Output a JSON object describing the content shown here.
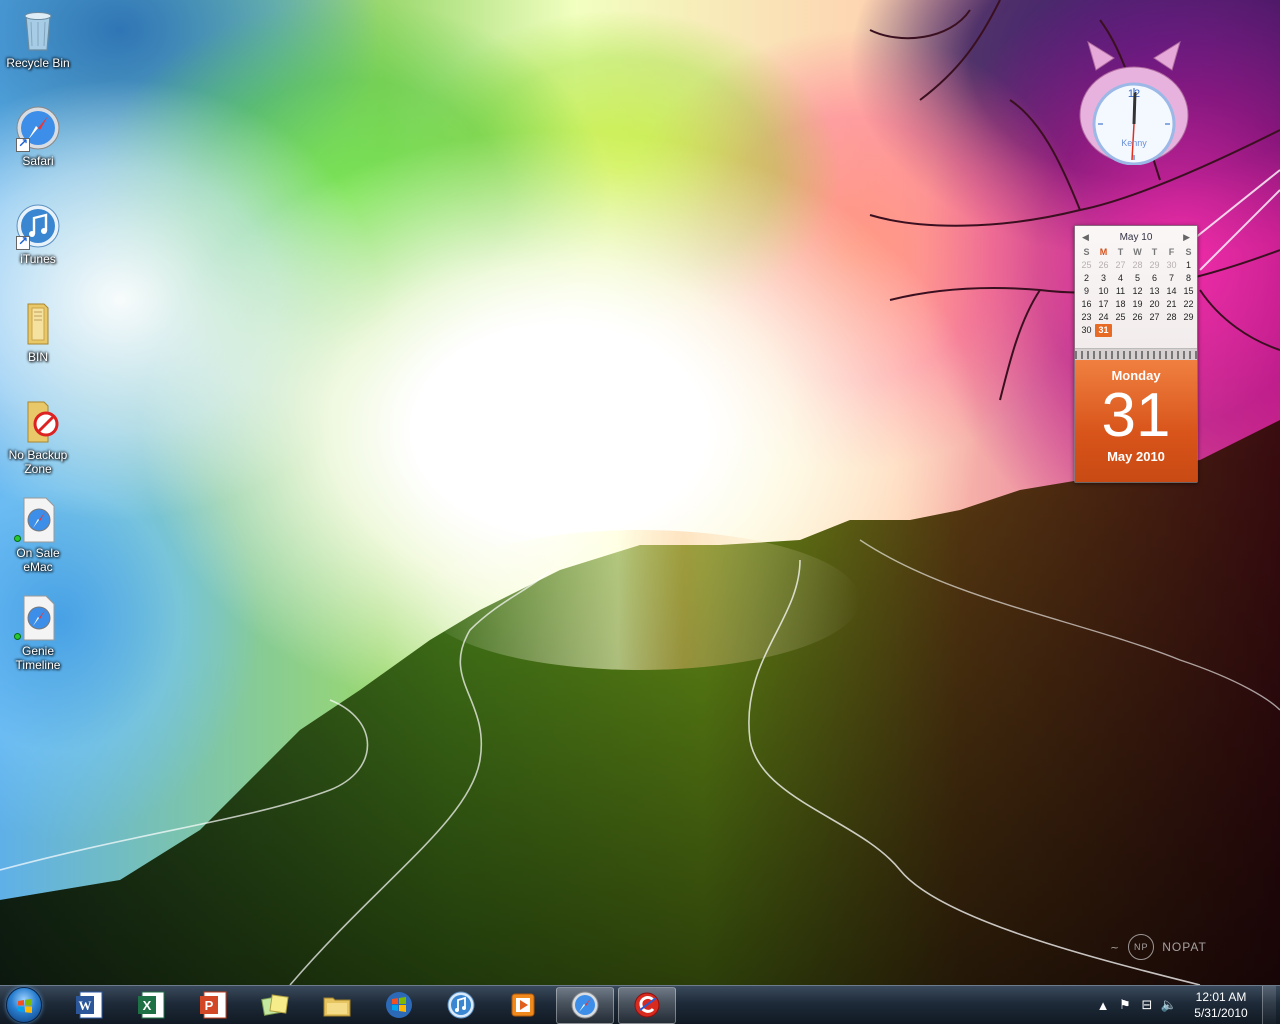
{
  "desktop": {
    "icons": [
      {
        "label": "Recycle Bin",
        "icon": "recycle-bin-icon"
      },
      {
        "label": "Safari",
        "icon": "safari-icon"
      },
      {
        "label": "iTunes",
        "icon": "itunes-icon"
      },
      {
        "label": "BIN",
        "icon": "folder-icon"
      },
      {
        "label": "No Backup Zone",
        "icon": "no-backup-folder-icon"
      },
      {
        "label": "On Sale eMac",
        "icon": "safari-webloc-icon"
      },
      {
        "label": "Genie Timeline",
        "icon": "safari-webloc-icon"
      }
    ]
  },
  "clock_gadget": {
    "name": "Kenny",
    "hour_mark": "12",
    "time_shown": "12:01"
  },
  "calendar_gadget": {
    "month_header": "May 10",
    "weekdays": [
      "S",
      "M",
      "T",
      "W",
      "T",
      "F",
      "S"
    ],
    "weeks": [
      [
        "25",
        "26",
        "27",
        "28",
        "29",
        "30",
        "1"
      ],
      [
        "2",
        "3",
        "4",
        "5",
        "6",
        "7",
        "8"
      ],
      [
        "9",
        "10",
        "11",
        "12",
        "13",
        "14",
        "15"
      ],
      [
        "16",
        "17",
        "18",
        "19",
        "20",
        "21",
        "22"
      ],
      [
        "23",
        "24",
        "25",
        "26",
        "27",
        "28",
        "29"
      ],
      [
        "30",
        "31",
        "",
        "",
        "",
        "",
        ""
      ]
    ],
    "today": "31",
    "day_name": "Monday",
    "day_number": "31",
    "month_year": "May 2010"
  },
  "watermark": {
    "text": "NOPAT"
  },
  "taskbar": {
    "pinned": [
      {
        "name": "word",
        "icon": "word-icon"
      },
      {
        "name": "excel",
        "icon": "excel-icon"
      },
      {
        "name": "powerpoint",
        "icon": "powerpoint-icon"
      },
      {
        "name": "sticky-notes",
        "icon": "sticky-notes-icon"
      },
      {
        "name": "explorer",
        "icon": "folder-explorer-icon"
      },
      {
        "name": "windows",
        "icon": "windows-logo-icon"
      },
      {
        "name": "itunes",
        "icon": "itunes-icon"
      },
      {
        "name": "media-player",
        "icon": "media-player-icon"
      },
      {
        "name": "safari",
        "icon": "safari-icon"
      },
      {
        "name": "ccleaner",
        "icon": "ccleaner-icon"
      }
    ],
    "tray": {
      "time": "12:01 AM",
      "date": "5/31/2010"
    }
  },
  "colors": {
    "calendar_accent": "#e76a25",
    "taskbar": "#1e2a38"
  }
}
